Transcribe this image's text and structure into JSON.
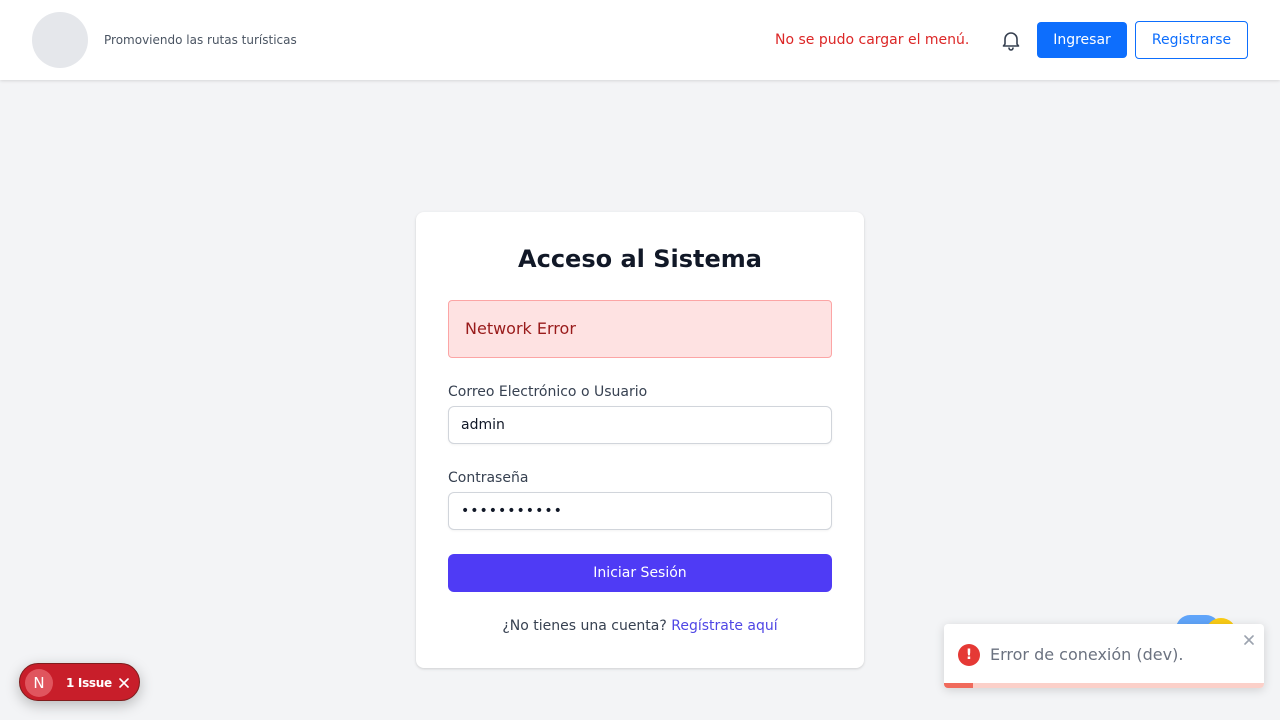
{
  "header": {
    "tagline": "Promoviendo las rutas turísticas",
    "menu_error": "No se pudo cargar el menú.",
    "login_label": "Ingresar",
    "register_label": "Registrarse",
    "icons": {
      "notifications": "bell-icon"
    }
  },
  "login": {
    "title": "Acceso al Sistema",
    "alert": "Network Error",
    "email_label": "Correo Electrónico o Usuario",
    "email_value": "admin",
    "password_label": "Contraseña",
    "password_value": "•••••••••••",
    "submit_label": "Iniciar Sesión",
    "signup_prompt": "¿No tienes una cuenta?",
    "signup_link": "Regístrate aquí"
  },
  "issues": {
    "avatar_letter": "N",
    "label": "1 Issue"
  },
  "toast": {
    "message": "Error de conexión (dev).",
    "icon": "!",
    "progress": 0.09
  },
  "colors": {
    "primary": "#0d6efd",
    "submit": "#4f3bf5",
    "error_text": "#dc2626",
    "alert_bg": "#fee2e2",
    "issue_bg": "#c81e2a",
    "toast_error": "#e53935"
  }
}
